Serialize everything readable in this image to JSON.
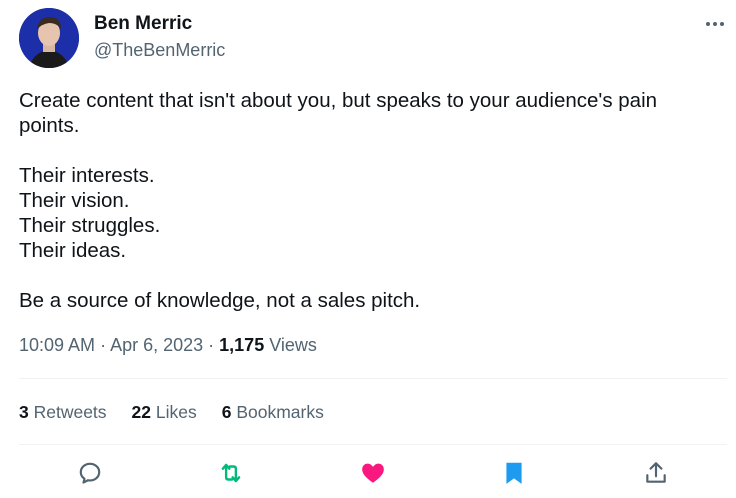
{
  "author": {
    "name": "Ben Merric",
    "handle": "@TheBenMerric"
  },
  "tweet": {
    "lines": [
      "Create content that isn't about you, but speaks to your audience's pain",
      "points.",
      "",
      "Their interests.",
      "Their vision.",
      "Their struggles.",
      "Their ideas.",
      "",
      "Be a source of knowledge, not a sales pitch."
    ]
  },
  "meta": {
    "time": "10:09 AM",
    "sep1": " · ",
    "date": "Apr 6, 2023",
    "sep2": " · ",
    "views_count": "1,175",
    "views_label": " Views"
  },
  "stats": {
    "retweets_count": "3",
    "retweets_label": " Retweets",
    "likes_count": "22",
    "likes_label": " Likes",
    "bookmarks_count": "6",
    "bookmarks_label": " Bookmarks"
  },
  "icons": {
    "more": "more-dots-icon",
    "reply": "reply-icon",
    "retweet": "retweet-icon",
    "like": "heart-icon",
    "bookmark": "bookmark-icon",
    "share": "share-icon"
  },
  "colors": {
    "text": "#0f1419",
    "secondary": "#536471",
    "retweet_active": "#00ba7c",
    "like_active": "#f91880",
    "bookmark_active": "#1d9bf0",
    "divider": "#eff3f4"
  }
}
